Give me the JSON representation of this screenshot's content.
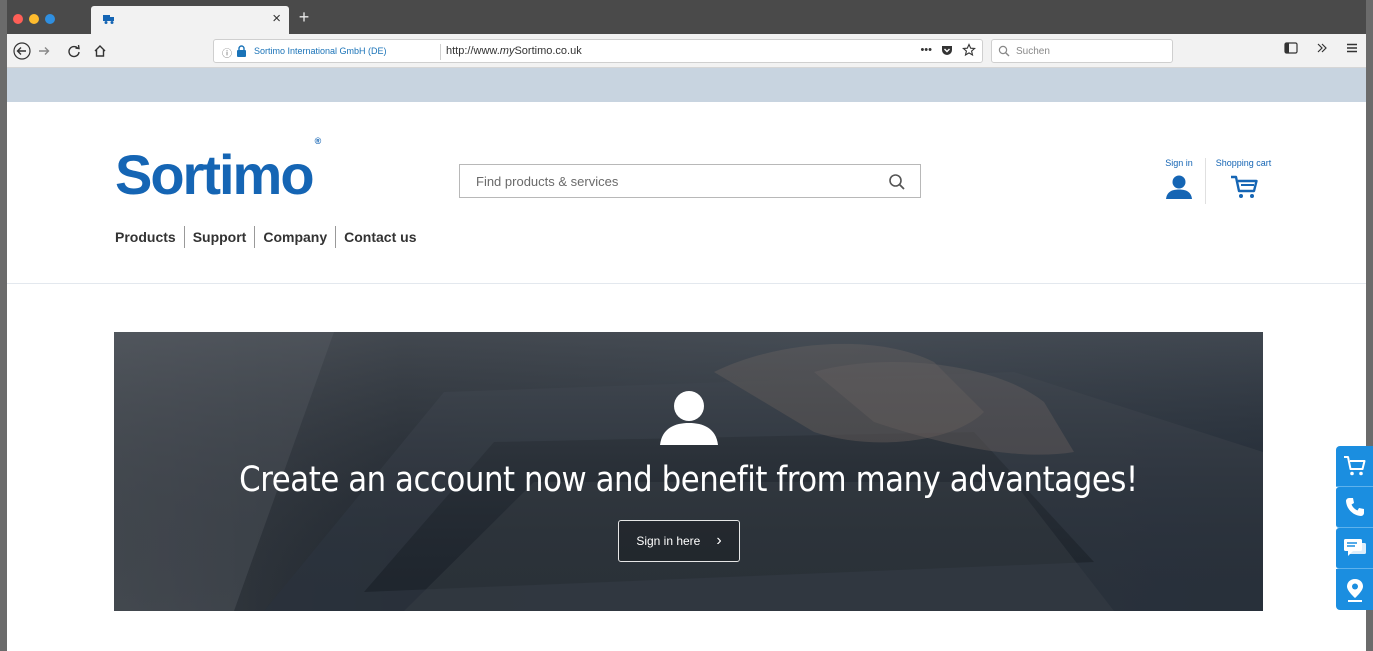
{
  "browser": {
    "tab": {
      "favicon": "truck-icon",
      "close_label": "×"
    },
    "new_tab_label": "+",
    "toolbar": {
      "back_icon": "back-arrow-icon",
      "forward_icon": "forward-arrow-icon",
      "reload_icon": "reload-icon",
      "home_icon": "home-icon"
    },
    "urlbar": {
      "identity": "Sortimo International GmbH (DE)",
      "url_prefix": "http://www.",
      "url_emph": "my",
      "url_suffix": "Sortimo.co.uk",
      "more_label": "•••"
    },
    "searchbar": {
      "placeholder": "Suchen"
    },
    "colors": {
      "accent": "#1a73b8"
    }
  },
  "site": {
    "logo": {
      "text": "Sortimo",
      "mark": "®"
    },
    "search": {
      "placeholder": "Find products & services"
    },
    "nav": [
      {
        "label": "Products"
      },
      {
        "label": "Support"
      },
      {
        "label": "Company"
      },
      {
        "label": "Contact us"
      }
    ],
    "account": {
      "label": "Sign in"
    },
    "cart": {
      "label": "Shopping cart"
    },
    "colors": {
      "brand": "#1565b4",
      "rail": "#1b8ee0"
    }
  },
  "hero": {
    "title": "Create an account now and benefit from many advantages!",
    "button_label": "Sign in here",
    "button_chevron": "›"
  },
  "rail": [
    {
      "icon": "cart-icon"
    },
    {
      "icon": "phone-icon"
    },
    {
      "icon": "chat-icon"
    },
    {
      "icon": "location-icon"
    }
  ]
}
